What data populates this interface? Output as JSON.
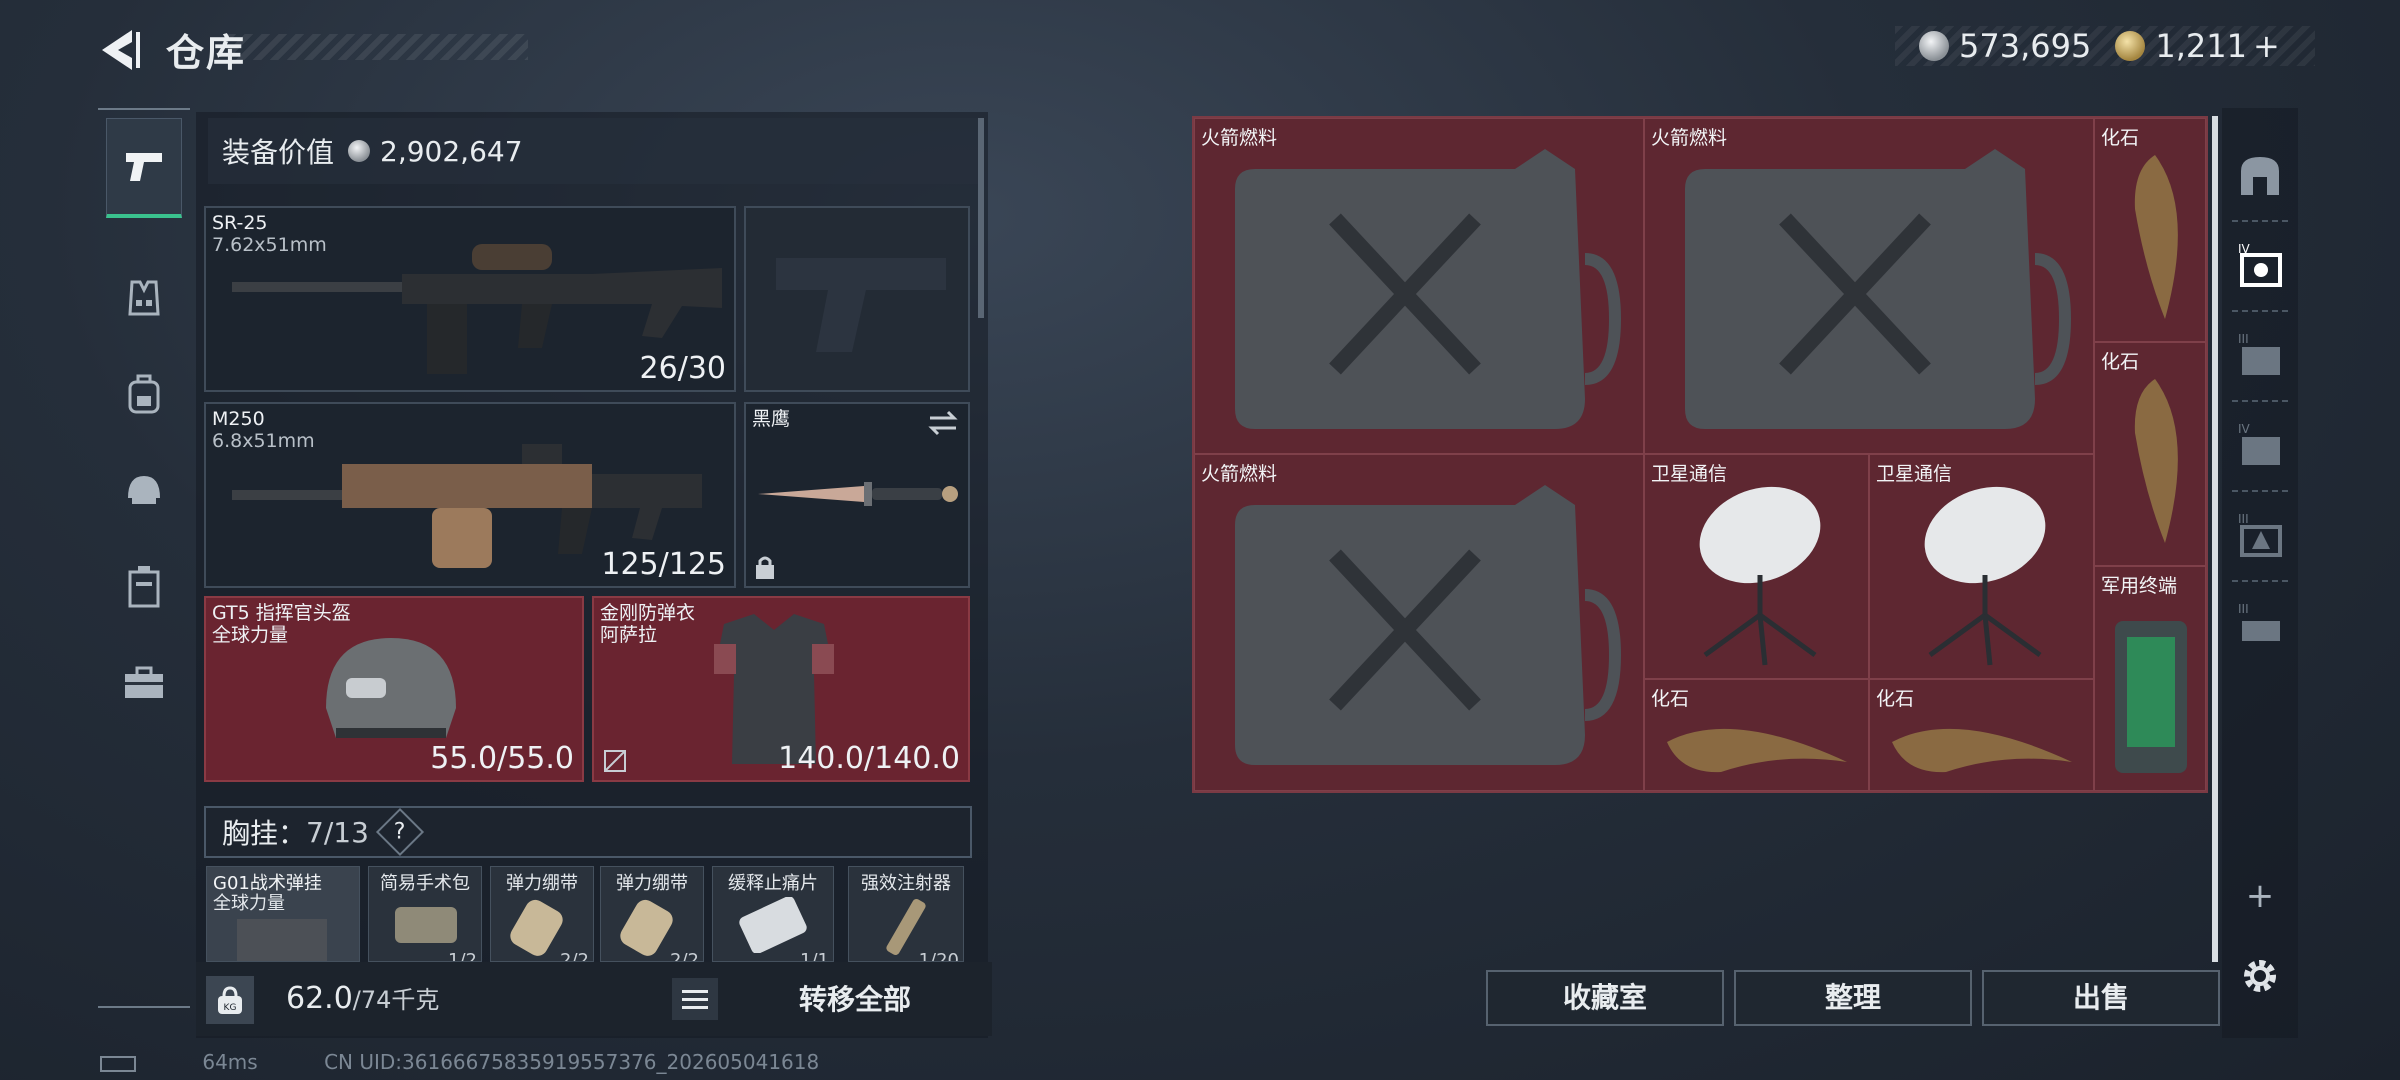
{
  "header": {
    "title": "仓库",
    "currency_silver": "573,695",
    "currency_gold": "1,211",
    "currency_gold_plus": "+"
  },
  "left_rail": {
    "items": [
      {
        "name": "weapons",
        "icon": "pistol-icon",
        "active": true
      },
      {
        "name": "armor",
        "icon": "vest-icon"
      },
      {
        "name": "backpack",
        "icon": "backpack-icon"
      },
      {
        "name": "helmet",
        "icon": "helmet-icon"
      },
      {
        "name": "consumables",
        "icon": "canister-icon"
      },
      {
        "name": "toolbox",
        "icon": "toolbox-icon"
      }
    ]
  },
  "equipment": {
    "value_label": "装备价值",
    "value": "2,902,647",
    "primary_weapon": {
      "name": "SR-25",
      "caliber": "7.62x51mm",
      "ammo": "26/30"
    },
    "secondary_weapon": {
      "name": "M250",
      "caliber": "6.8x51mm",
      "ammo": "125/125"
    },
    "melee": {
      "name": "黑鹰"
    },
    "helmet": {
      "name": "GT5 指挥官头盔",
      "sub": "全球力量",
      "durability": "55.0/55.0"
    },
    "armor": {
      "name": "金刚防弹衣",
      "sub": "阿萨拉",
      "durability": "140.0/140.0"
    },
    "chest_rig": {
      "label": "胸挂：",
      "count": "7/13",
      "help": "?"
    },
    "rig_items": [
      {
        "name": "G01战术弹挂",
        "sub": "全球力量",
        "count": ""
      },
      {
        "name": "简易手术包",
        "count": "1/2"
      },
      {
        "name": "弹力绷带",
        "count": "2/2"
      },
      {
        "name": "弹力绷带",
        "count": "2/2"
      },
      {
        "name": "缓释止痛片",
        "count": "1/1"
      },
      {
        "name": "强效注射器",
        "count": "1/20"
      }
    ]
  },
  "footer": {
    "weight": "62.0",
    "weight_capacity": "/74千克",
    "weight_icon_label": "KG",
    "transfer_all": "转移全部",
    "status_ping": "64ms",
    "status_uid": "CN UID:36166675835919557376_202605041618"
  },
  "storage": {
    "items": [
      {
        "name": "火箭燃料",
        "type": "canister"
      },
      {
        "name": "火箭燃料",
        "type": "canister"
      },
      {
        "name": "火箭燃料",
        "type": "canister"
      },
      {
        "name": "化石",
        "type": "fossil"
      },
      {
        "name": "化石",
        "type": "fossil"
      },
      {
        "name": "卫星通信",
        "type": "dish"
      },
      {
        "name": "卫星通信",
        "type": "dish"
      },
      {
        "name": "军用终端",
        "type": "terminal"
      },
      {
        "name": "化石",
        "type": "fossil"
      },
      {
        "name": "化石",
        "type": "fossil"
      }
    ],
    "actions": {
      "collection": "收藏室",
      "organize": "整理",
      "sell": "出售"
    },
    "add_label": "+"
  },
  "right_rail": {
    "tabs": [
      "safe-room-icon",
      "storage-iv-icon",
      "storage-iii-icon",
      "storage-iv-b-icon",
      "storage-iii-b-icon",
      "storage-iii-c-icon"
    ]
  },
  "colors": {
    "accent_green": "#3ac28e",
    "slot_red": "#6a2430",
    "panel_dark": "#1c242e"
  }
}
